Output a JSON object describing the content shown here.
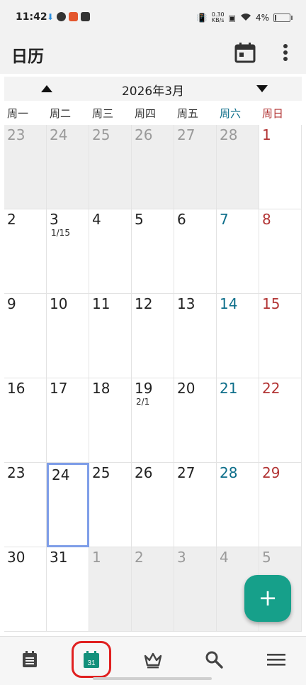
{
  "status": {
    "time": "11:42",
    "net_speed_top": "0.30",
    "net_speed_unit": "KB/s",
    "battery": "4%"
  },
  "appbar": {
    "title": "日历"
  },
  "month": {
    "label": "2026年3月"
  },
  "weekdays": [
    "周一",
    "周二",
    "周三",
    "周四",
    "周五",
    "周六",
    "周日"
  ],
  "weeks": [
    [
      {
        "day": "23",
        "other": true
      },
      {
        "day": "24",
        "other": true
      },
      {
        "day": "25",
        "other": true
      },
      {
        "day": "26",
        "other": true
      },
      {
        "day": "27",
        "other": true
      },
      {
        "day": "28",
        "other": true
      },
      {
        "day": "1"
      }
    ],
    [
      {
        "day": "2"
      },
      {
        "day": "3",
        "lunar": "1/15"
      },
      {
        "day": "4"
      },
      {
        "day": "5"
      },
      {
        "day": "6"
      },
      {
        "day": "7"
      },
      {
        "day": "8"
      }
    ],
    [
      {
        "day": "9"
      },
      {
        "day": "10"
      },
      {
        "day": "11"
      },
      {
        "day": "12"
      },
      {
        "day": "13"
      },
      {
        "day": "14"
      },
      {
        "day": "15"
      }
    ],
    [
      {
        "day": "16"
      },
      {
        "day": "17"
      },
      {
        "day": "18"
      },
      {
        "day": "19",
        "lunar": "2/1"
      },
      {
        "day": "20"
      },
      {
        "day": "21"
      },
      {
        "day": "22"
      }
    ],
    [
      {
        "day": "23"
      },
      {
        "day": "24",
        "today": true
      },
      {
        "day": "25"
      },
      {
        "day": "26"
      },
      {
        "day": "27"
      },
      {
        "day": "28"
      },
      {
        "day": "29"
      }
    ],
    [
      {
        "day": "30"
      },
      {
        "day": "31"
      },
      {
        "day": "1",
        "other": true
      },
      {
        "day": "2",
        "other": true
      },
      {
        "day": "3",
        "other": true
      },
      {
        "day": "4",
        "other": true
      },
      {
        "day": "5",
        "other": true
      }
    ]
  ],
  "fab": {
    "label": "+"
  },
  "nav": {
    "calendar_icon_day": "31",
    "items": [
      "notes-icon",
      "calendar-icon",
      "crown-icon",
      "search-icon",
      "menu-icon"
    ],
    "active_index": 1
  },
  "colors": {
    "saturday": "#0d6e8a",
    "sunday": "#b23434",
    "accent": "#16a08a",
    "today_border": "#7f9ee8"
  }
}
